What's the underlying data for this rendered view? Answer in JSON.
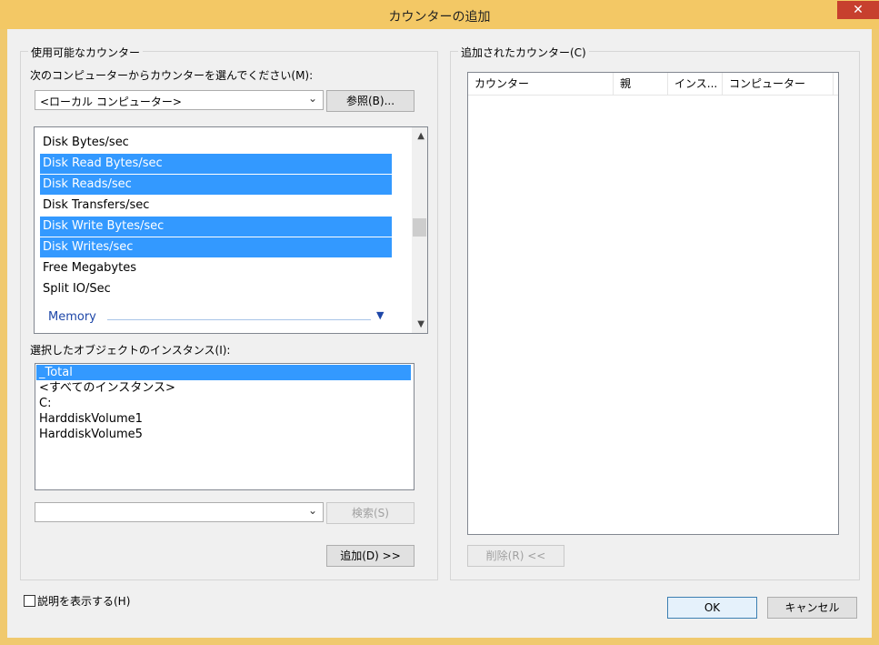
{
  "window": {
    "title": "カウンターの追加",
    "close_glyph": "✕"
  },
  "available_group": {
    "legend": "使用可能なカウンター",
    "computer_label": "次のコンピューターからカウンターを選んでください(M):",
    "computer_value": "<ローカル コンピューター>",
    "browse_button": "参照(B)...",
    "counters": [
      {
        "label": "Disk Bytes/sec",
        "selected": false
      },
      {
        "label": "Disk Read Bytes/sec",
        "selected": true
      },
      {
        "label": "Disk Reads/sec",
        "selected": true
      },
      {
        "label": "Disk Transfers/sec",
        "selected": false
      },
      {
        "label": "Disk Write Bytes/sec",
        "selected": true
      },
      {
        "label": "Disk Writes/sec",
        "selected": true
      },
      {
        "label": "Free Megabytes",
        "selected": false
      },
      {
        "label": "Split IO/Sec",
        "selected": false
      }
    ],
    "next_group_header": "Memory",
    "instances_label": "選択したオブジェクトのインスタンス(I):",
    "instances": [
      {
        "label": "_Total",
        "selected": true
      },
      {
        "label": "<すべてのインスタンス>",
        "selected": false
      },
      {
        "label": "C:",
        "selected": false
      },
      {
        "label": "HarddiskVolume1",
        "selected": false
      },
      {
        "label": "HarddiskVolume5",
        "selected": false
      }
    ],
    "search_value": "",
    "search_button": "検索(S)",
    "add_button": "追加(D) >>"
  },
  "added_group": {
    "legend": "追加されたカウンター(C)",
    "columns": [
      "カウンター",
      "親",
      "インス...",
      "コンピューター"
    ],
    "remove_button": "削除(R) <<"
  },
  "footer": {
    "show_description_label": "説明を表示する(H)",
    "ok_button": "OK",
    "cancel_button": "キャンセル"
  },
  "colors": {
    "title_bar": "#f3c865",
    "close_button": "#c7402e",
    "selection": "#3399ff",
    "group_header": "#1e47a8"
  }
}
